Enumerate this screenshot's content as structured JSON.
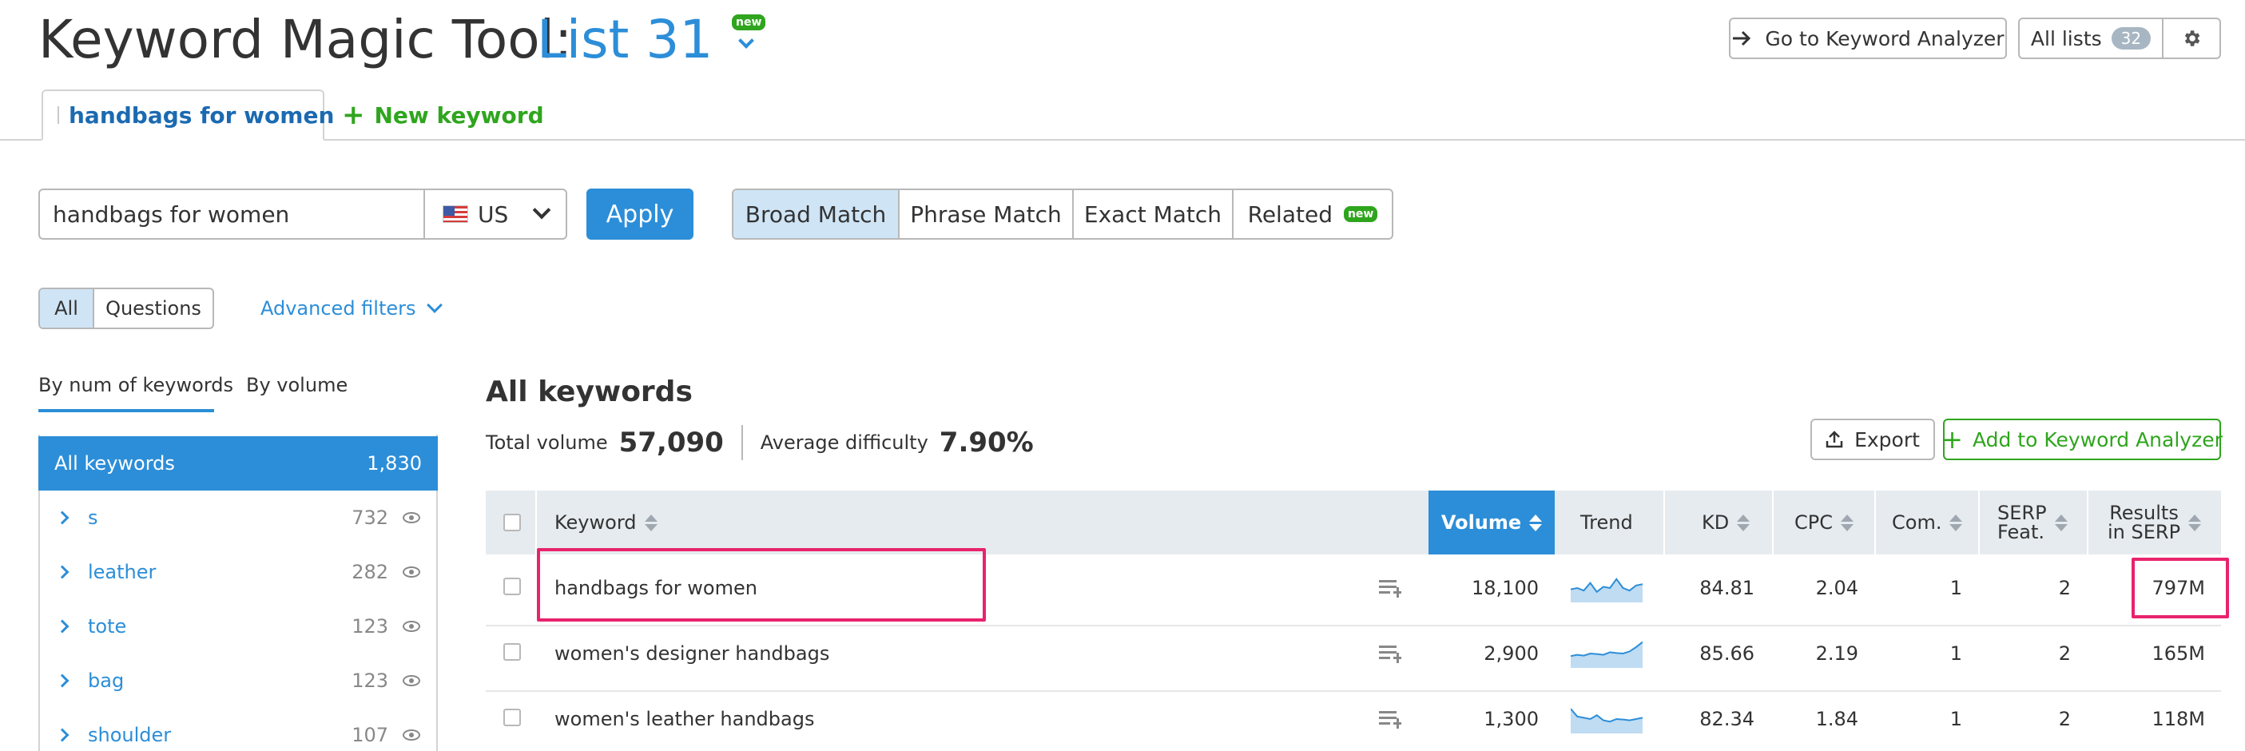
{
  "header": {
    "title": "Keyword Magic Tool:",
    "list_name": "List 31",
    "new_badge": "new",
    "go_analyzer": "Go to Keyword Analyzer",
    "all_lists": "All lists",
    "all_lists_count": "32"
  },
  "tabs": {
    "active": "handbags for women",
    "new_keyword": "New keyword"
  },
  "search": {
    "value": "handbags for women",
    "country": "US",
    "apply": "Apply",
    "match_types": [
      "Broad Match",
      "Phrase Match",
      "Exact Match",
      "Related"
    ],
    "related_badge": "new"
  },
  "filters": {
    "all": "All",
    "questions": "Questions",
    "advanced": "Advanced filters"
  },
  "sidebar": {
    "tab_by_num": "By num of keywords",
    "tab_by_volume": "By volume",
    "groups": [
      {
        "label": "All keywords",
        "count": "1,830"
      },
      {
        "label": "s",
        "count": "732"
      },
      {
        "label": "leather",
        "count": "282"
      },
      {
        "label": "tote",
        "count": "123"
      },
      {
        "label": "bag",
        "count": "123"
      },
      {
        "label": "shoulder",
        "count": "107"
      }
    ]
  },
  "main": {
    "heading": "All keywords",
    "total_volume_label": "Total volume",
    "total_volume": "57,090",
    "avg_difficulty_label": "Average difficulty",
    "avg_difficulty": "7.90%",
    "export": "Export",
    "add_analyzer": "Add to Keyword Analyzer"
  },
  "table": {
    "columns": {
      "keyword": "Keyword",
      "volume": "Volume",
      "trend": "Trend",
      "kd": "KD",
      "cpc": "CPC",
      "com": "Com.",
      "serp1": "SERP",
      "serp2": "Feat.",
      "results1": "Results",
      "results2": "in SERP"
    },
    "rows": [
      {
        "keyword": "handbags for women",
        "volume": "18,100",
        "kd": "84.81",
        "cpc": "2.04",
        "com": "1",
        "serp": "2",
        "results": "797M",
        "trend": [
          0.45,
          0.5,
          0.4,
          0.7,
          0.35,
          0.55,
          0.5,
          0.85,
          0.5,
          0.4,
          0.6,
          0.65
        ]
      },
      {
        "keyword": "women's designer handbags",
        "volume": "2,900",
        "kd": "85.66",
        "cpc": "2.19",
        "com": "1",
        "serp": "2",
        "results": "165M",
        "trend": [
          0.4,
          0.45,
          0.42,
          0.5,
          0.48,
          0.45,
          0.55,
          0.52,
          0.5,
          0.58,
          0.75,
          0.95
        ]
      },
      {
        "keyword": "women's leather handbags",
        "volume": "1,300",
        "kd": "82.34",
        "cpc": "1.84",
        "com": "1",
        "serp": "2",
        "results": "118M",
        "trend": [
          0.9,
          0.6,
          0.55,
          0.5,
          0.65,
          0.45,
          0.4,
          0.5,
          0.48,
          0.45,
          0.5,
          0.55
        ]
      }
    ]
  },
  "colors": {
    "accent": "#2c8ed8",
    "green": "#2fa51e",
    "highlight": "#e8236d"
  }
}
